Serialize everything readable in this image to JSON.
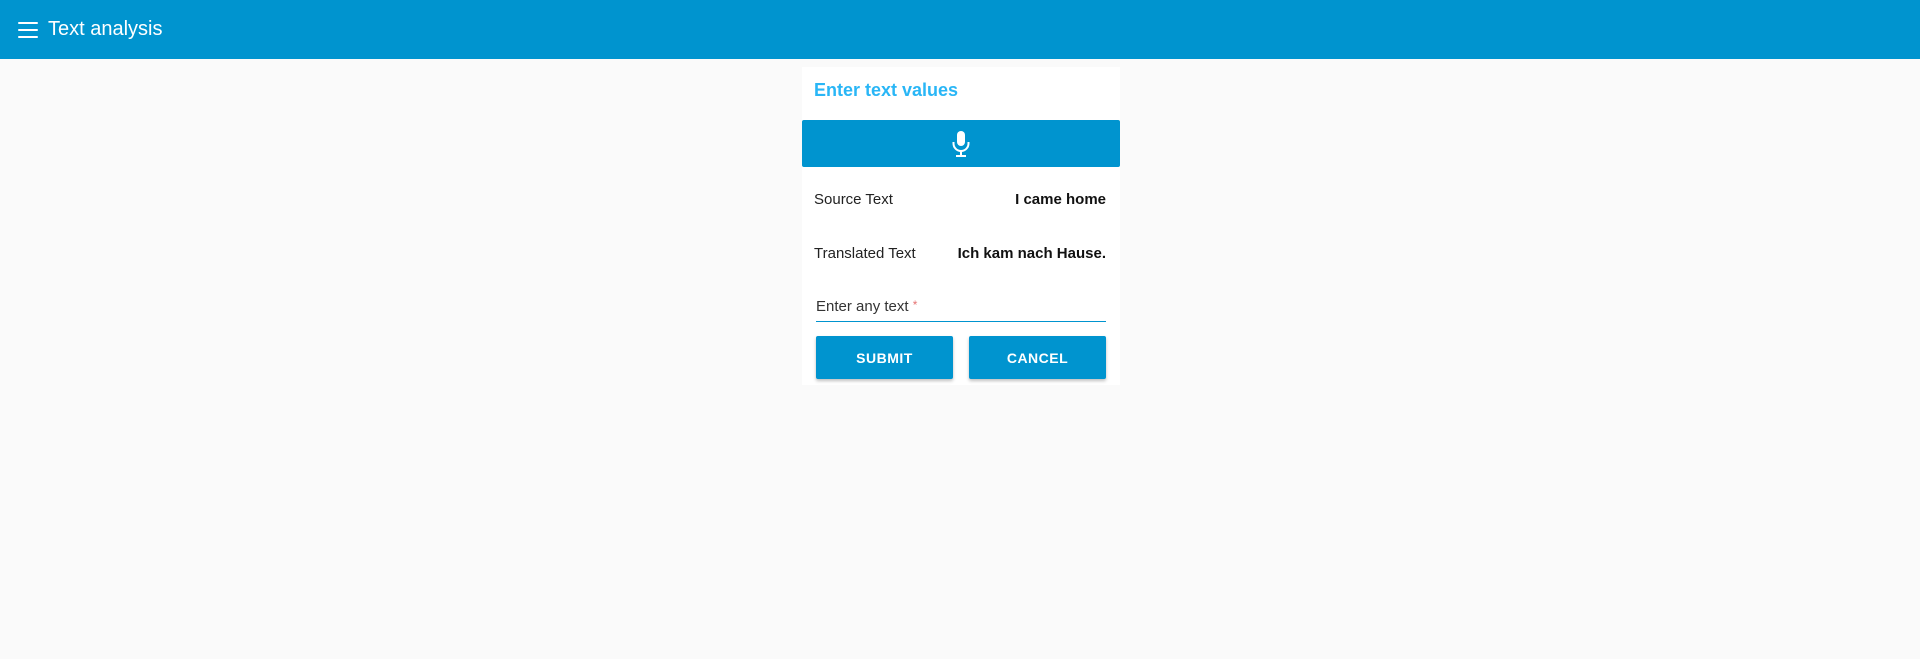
{
  "header": {
    "menu_icon": "hamburger-menu-icon",
    "title": "Text analysis"
  },
  "card": {
    "title": "Enter text values",
    "mic_icon": "microphone-icon",
    "source_label": "Source Text",
    "source_value": "I came home",
    "translated_label": "Translated Text",
    "translated_value": "Ich kam nach Hause.",
    "input_label": "Enter any text",
    "input_required_mark": "*",
    "input_value": "",
    "submit_label": "SUBMIT",
    "cancel_label": "CANCEL"
  },
  "colors": {
    "primary": "#0094cf",
    "card_title": "#29b6f6",
    "background": "#fafafa"
  }
}
